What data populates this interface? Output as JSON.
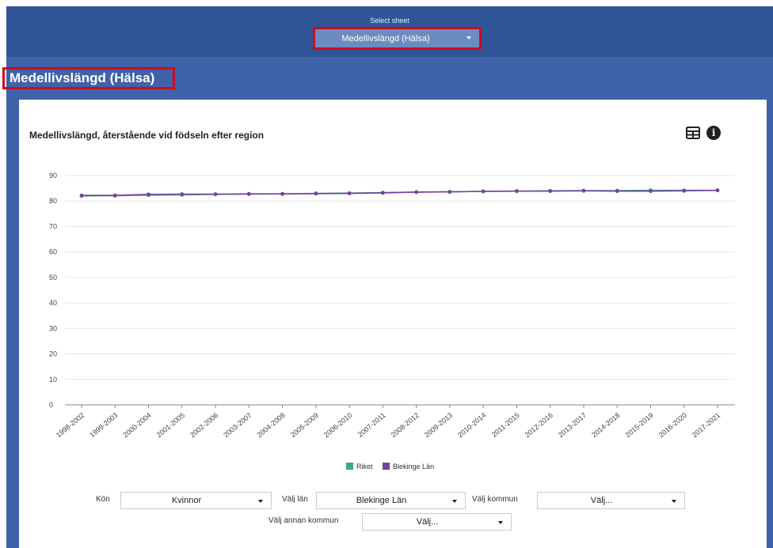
{
  "header": {
    "select_label": "Select sheet",
    "selected_sheet": "Medellivslängd (Hälsa)"
  },
  "page_title": "Medellivslängd (Hälsa)",
  "chart_title": "Medellivslängd, återstående vid födseln efter region",
  "icons": {
    "table": "table-icon",
    "info": "info-icon"
  },
  "chart_data": {
    "type": "line",
    "title": "Medellivslängd, återstående vid födseln efter region",
    "xlabel": "",
    "ylabel": "",
    "ylim": [
      0,
      90
    ],
    "yticks": [
      0,
      10,
      20,
      30,
      40,
      50,
      60,
      70,
      80,
      90
    ],
    "grid": true,
    "legend_position": "bottom",
    "categories": [
      "1998-2002",
      "1999-2003",
      "2000-2004",
      "2001-2005",
      "2002-2006",
      "2003-2007",
      "2004-2008",
      "2005-2009",
      "2006-2010",
      "2007-2011",
      "2008-2012",
      "2009-2013",
      "2010-2014",
      "2011-2015",
      "2012-2016",
      "2013-2017",
      "2014-2018",
      "2015-2019",
      "2016-2020",
      "2017-2021"
    ],
    "series": [
      {
        "name": "Riket",
        "color": "#3aa88a",
        "values": [
          82.0,
          82.1,
          82.3,
          82.4,
          82.6,
          82.7,
          82.8,
          83.0,
          83.1,
          83.3,
          83.5,
          83.6,
          83.8,
          83.9,
          84.0,
          84.1,
          84.1,
          84.2,
          84.2,
          84.2
        ]
      },
      {
        "name": "Blekinge Län",
        "color": "#7b3fa0",
        "values": [
          82.2,
          82.2,
          82.6,
          82.7,
          82.7,
          82.8,
          82.8,
          82.9,
          83.0,
          83.2,
          83.5,
          83.6,
          83.8,
          83.9,
          83.9,
          84.0,
          83.9,
          83.9,
          84.0,
          84.2
        ]
      }
    ]
  },
  "filters": {
    "kon_label": "Kön",
    "kon_value": "Kvinnor",
    "lan_label": "Välj län",
    "lan_value": "Blekinge Län",
    "kommun_label": "Välj kommun",
    "kommun_value": "Välj...",
    "annan_label": "Välj annan kommun",
    "annan_value": "Välj..."
  }
}
